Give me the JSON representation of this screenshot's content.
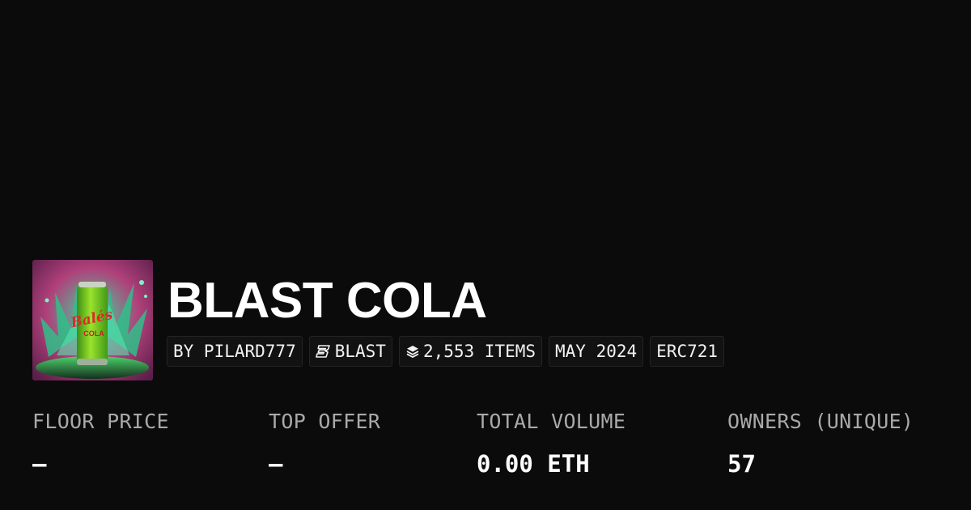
{
  "collection": {
    "title": "BLAST COLA",
    "thumbnail_icon": "soda-can-image",
    "badges": [
      {
        "label": "BY PILARD777",
        "icon": ""
      },
      {
        "label": "BLAST",
        "icon": "blast-logo-icon"
      },
      {
        "label": "2,553 ITEMS",
        "icon": "layers-icon"
      },
      {
        "label": "MAY 2024",
        "icon": ""
      },
      {
        "label": "ERC721",
        "icon": ""
      }
    ]
  },
  "stats": [
    {
      "label": "FLOOR PRICE",
      "value": "–"
    },
    {
      "label": "TOP OFFER",
      "value": "–"
    },
    {
      "label": "TOTAL VOLUME",
      "value": "0.00 ETH"
    },
    {
      "label": "OWNERS (UNIQUE)",
      "value": "57"
    }
  ],
  "colors": {
    "background": "#0b0b0b",
    "text": "#ffffff",
    "muted": "#a9a9a9",
    "badge_bg": "#121212",
    "badge_border": "#242424"
  }
}
